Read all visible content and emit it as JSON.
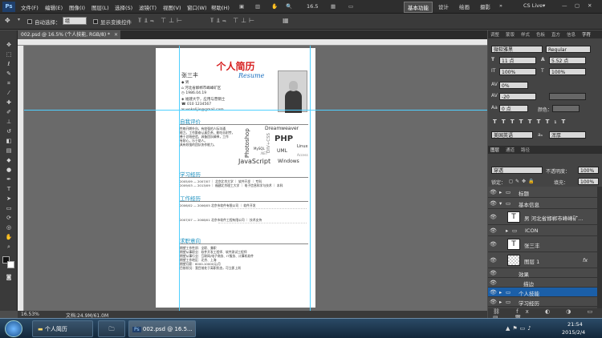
{
  "app": {
    "logo": "Ps"
  },
  "menu": [
    "文件(F)",
    "编辑(E)",
    "图像(I)",
    "图层(L)",
    "选择(S)",
    "滤镜(T)",
    "视图(V)",
    "窗口(W)",
    "帮助(H)"
  ],
  "zoom_field": "16.5",
  "workspaces": {
    "active": "基本功能",
    "items": [
      "设计",
      "绘画",
      "摄影"
    ],
    "more": "»",
    "cslive": "CS Live▾"
  },
  "options": {
    "auto_select": "自动选择：",
    "group_value": "组",
    "show_transform": "显示变换控件"
  },
  "document": {
    "tab_title": "002.psd @ 16.5% (个人技能, RGB/8) *",
    "zoom_status": "16.53%",
    "doc_status": "文档:24.9M/61.0M"
  },
  "resume": {
    "title": "个人简历",
    "subtitle": "Resume",
    "name": "张三丰",
    "info": [
      "男",
      "河北省邯郸市峰峰矿区",
      "1986.04.19",
      "福建大学，应用与营销士",
      "010 1234567",
      "wokelijie@gmail.com"
    ],
    "sections": {
      "self": "自我评价",
      "edu": "学习经历",
      "work": "工作经历",
      "job": "求职意向"
    },
    "self_text": [
      "性格开朗外向，有较强的人际沟通",
      "能力，工作勤奋认真负责，能吃苦耐劳，",
      "善于总结经验，具备团队精神，工作",
      "有耐心，乐于助人。",
      "具有较强的团队协作能力。"
    ],
    "skills": [
      "Dreamweaver",
      "PHP",
      "Linux",
      "Photoshop",
      "DIV+CSS",
      "MySQL",
      "UML",
      "JavaScript",
      "Windows",
      ".NET",
      "Access"
    ],
    "edu": [
      "2005/09 — 2007/07  ｜ 北京北京大学 ｜ 软件开发 ｜ 专科",
      "2009/03 — 2013/09 ｜ 福建北京理工大学 ｜ 电子信息科学与技术 ｜ 本科"
    ],
    "work": [
      "2006/02 — 2006/05  北京市软件有限公司  ｜ 软件开发",
      "2007/07 — 2008/01  北京市软件工程有限公司  ｜ 技术支持"
    ],
    "job": [
      "期望工作性质：全职、兼职",
      "期望从事职业：软件开发工程师、软件测试工程师",
      "期望从事行业：互联网/电子商务、IT服务、计算机软件",
      "期望工作地区：北京、上海",
      "期望月薪：6000-10000元/月",
      "目前状况：我目前处于离职状态，可立即上岗"
    ]
  },
  "panels": {
    "top_tabs": [
      "调整",
      "蒙版",
      "样式",
      "色板",
      "直方",
      "信息",
      "字符"
    ],
    "font": "微软雅黑",
    "font_style": "Regular",
    "font_size": "11 点",
    "leading": "5.52 点",
    "scale_v": "100%",
    "scale_h": "100%",
    "tracking_left": "0%",
    "tracking": "-20",
    "baseline": "0 点",
    "color_label": "颜色：",
    "language": "美国英语",
    "aa": "浑厚",
    "layers_tabs": [
      "图层",
      "通道",
      "路径"
    ],
    "blend": "穿透",
    "opacity_label": "不透明度：",
    "opacity": "100%",
    "lock_label": "锁定：",
    "fill_label": "填充：",
    "fill": "100%",
    "layers": [
      "标题",
      "基本信息",
      "男 河北省邯郸市峰峰矿...",
      "ICON",
      "张三丰",
      "图层 1",
      "效果",
      "描边",
      "个人技能",
      "学习经历"
    ],
    "fx": "fx"
  },
  "taskbar": {
    "btn1": "个人简历",
    "btn2": "002.psd @ 16.5...",
    "time": "21:54",
    "date": "2015/2/4"
  }
}
